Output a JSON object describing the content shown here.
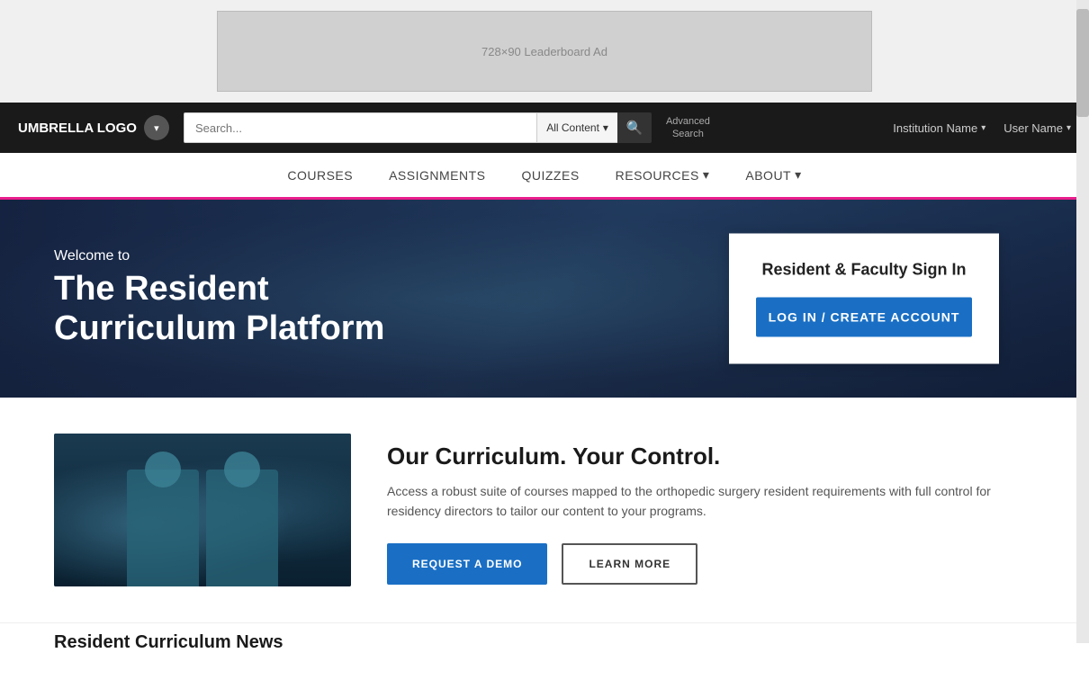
{
  "ad": {
    "label": "728×90 Leaderboard Ad"
  },
  "header": {
    "logo": "UMBRELLA LOGO",
    "search": {
      "placeholder": "Search...",
      "filter_label": "All Content",
      "filter_chevron": "▾",
      "search_icon": "🔍",
      "advanced_label": "Advanced\nSearch"
    },
    "institution": "Institution Name",
    "user": "User Name",
    "chevron": "▾"
  },
  "nav": {
    "items": [
      {
        "label": "COURSES"
      },
      {
        "label": "ASSIGNMENTS"
      },
      {
        "label": "QUIZZES"
      },
      {
        "label": "RESOURCES",
        "has_dropdown": true
      },
      {
        "label": "ABOUT",
        "has_dropdown": true
      }
    ]
  },
  "hero": {
    "welcome": "Welcome to",
    "title_line1": "The Resident",
    "title_line2": "Curriculum Platform",
    "signin_title": "Resident & Faculty Sign In",
    "login_button": "LOG IN / CREATE ACCOUNT"
  },
  "curriculum": {
    "heading": "Our Curriculum.  Your Control.",
    "description": "Access a robust suite of courses mapped to the orthopedic surgery resident requirements with full control for residency directors to tailor our content to your programs.",
    "demo_button": "REQUEST A DEMO",
    "learn_button": "LEARN MORE"
  },
  "news": {
    "heading": "Resident Curriculum News"
  }
}
